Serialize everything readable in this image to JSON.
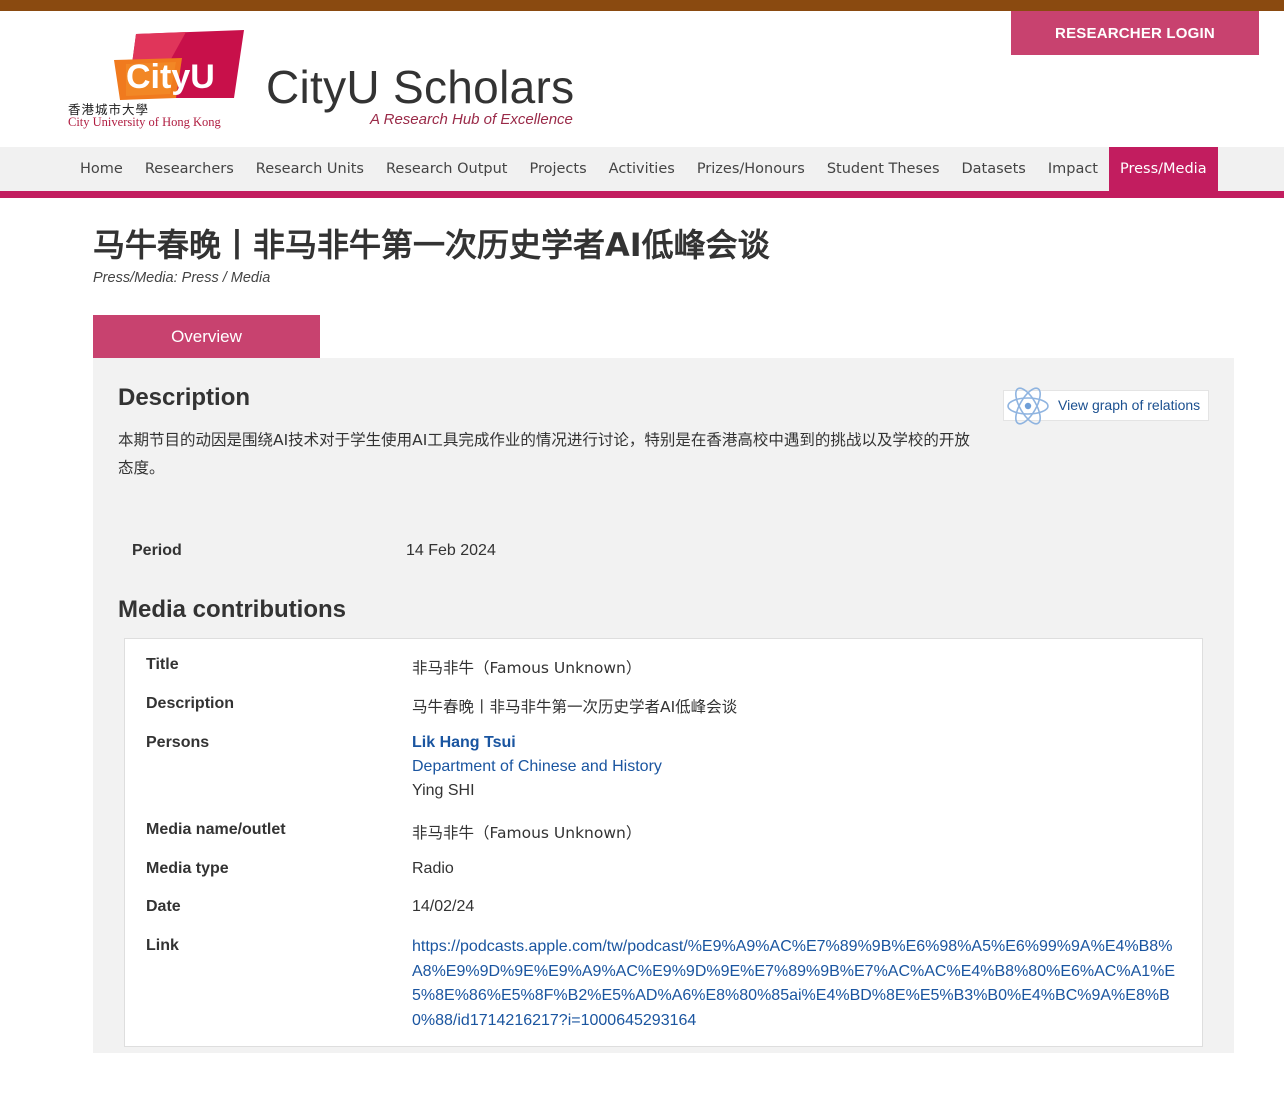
{
  "header": {
    "login_label": "RESEARCHER LOGIN",
    "logo_text": "CityU",
    "logo_zh": "香港城市大學",
    "logo_en": "City University of Hong Kong",
    "site_title": "CityU Scholars",
    "site_tagline": "A Research Hub of Excellence"
  },
  "nav": {
    "items": [
      {
        "label": "Home"
      },
      {
        "label": "Researchers"
      },
      {
        "label": "Research Units"
      },
      {
        "label": "Research Output"
      },
      {
        "label": "Projects"
      },
      {
        "label": "Activities"
      },
      {
        "label": "Prizes/Honours"
      },
      {
        "label": "Student Theses"
      },
      {
        "label": "Datasets"
      },
      {
        "label": "Impact"
      },
      {
        "label": "Press/Media"
      }
    ],
    "active_index": 10
  },
  "page": {
    "title": "马牛春晚丨非马非牛第一次历史学者AI低峰会谈",
    "type": "Press/Media: Press / Media",
    "tab_overview": "Overview",
    "description_heading": "Description",
    "description_text": "本期节目的动因是围绕AI技术对于学生使用AI工具完成作业的情况进行讨论，特别是在香港高校中遇到的挑战以及学校的开放态度。",
    "graph_link": "View graph of relations",
    "period_label": "Period",
    "period_value": "14 Feb 2024",
    "media_heading": "Media contributions"
  },
  "media": {
    "title_label": "Title",
    "title_value": "非马非牛（Famous Unknown）",
    "description_label": "Description",
    "description_value": "马牛春晚丨非马非牛第一次历史学者AI低峰会谈",
    "persons_label": "Persons",
    "person_name": "Lik Hang Tsui",
    "person_dept": "Department of Chinese and History",
    "person_other": "Ying SHI",
    "outlet_label": "Media name/outlet",
    "outlet_value": "非马非牛（Famous Unknown）",
    "type_label": "Media type",
    "type_value": "Radio",
    "date_label": "Date",
    "date_value": "14/02/24",
    "link_label": "Link",
    "link_value": "https://podcasts.apple.com/tw/podcast/%E9%A9%AC%E7%89%9B%E6%98%A5%E6%99%9A%E4%B8%A8%E9%9D%9E%E9%A9%AC%E9%9D%9E%E7%89%9B%E7%AC%AC%E4%B8%80%E6%AC%A1%E5%8E%86%E5%8F%B2%E5%AD%A6%E8%80%85ai%E4%BD%8E%E5%B3%B0%E4%BC%9A%E8%B0%88/id1714216217?i=1000645293164"
  },
  "colors": {
    "brand_magenta": "#c21d5f",
    "button_pink": "#c8426f",
    "top_strip": "#8a4a10",
    "link_blue": "#1a55a0"
  }
}
